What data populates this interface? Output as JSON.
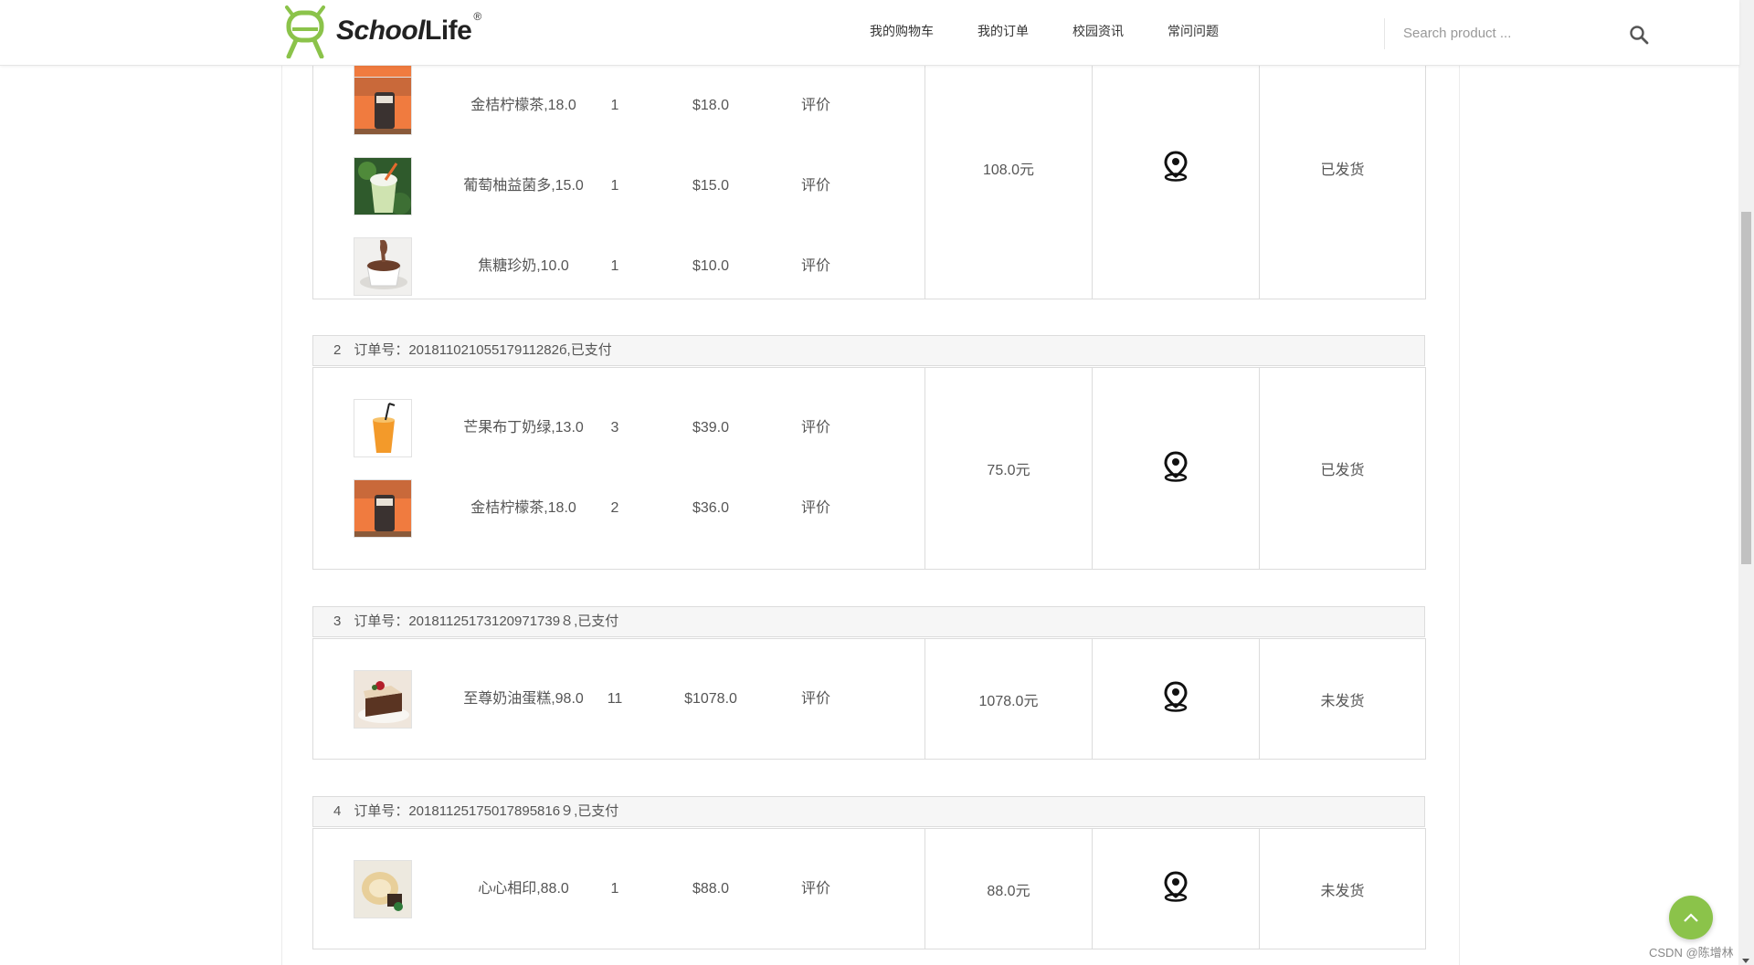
{
  "header": {
    "logo_text_italic": "School",
    "logo_text_bold": "Life",
    "logo_reg": "®",
    "nav": [
      "我的购物车",
      "我的订单",
      "校园资讯",
      "常问问题"
    ],
    "search_placeholder": "Search product ..."
  },
  "orders": [
    {
      "total": "108.0元",
      "status": "已发货",
      "items": [
        {
          "name": "金桔柠檬茶,18.0",
          "qty": "1",
          "price": "$18.0",
          "review": "评价",
          "thumb": "drink-orange-bg"
        },
        {
          "name": "葡萄柚益菌多,15.0",
          "qty": "1",
          "price": "$15.0",
          "review": "评价",
          "thumb": "drink-green"
        },
        {
          "name": "焦糖珍奶,10.0",
          "qty": "1",
          "price": "$10.0",
          "review": "评价",
          "thumb": "cocoa-cup"
        }
      ]
    },
    {
      "index": "2",
      "header": "订单号：20181102105517911282б,已支付",
      "total": "75.0元",
      "status": "已发货",
      "items": [
        {
          "name": "芒果布丁奶绿,13.0",
          "qty": "3",
          "price": "$39.0",
          "review": "评价",
          "thumb": "mango-drink"
        },
        {
          "name": "金桔柠檬茶,18.0",
          "qty": "2",
          "price": "$36.0",
          "review": "评价",
          "thumb": "drink-orange-bg"
        }
      ]
    },
    {
      "index": "3",
      "header": "订单号：20181125173120971739８,已支付",
      "total": "1078.0元",
      "status": "未发货",
      "items": [
        {
          "name": "至尊奶油蛋糕,98.0",
          "qty": "11",
          "price": "$1078.0",
          "review": "评价",
          "thumb": "cake-slice"
        }
      ]
    },
    {
      "index": "4",
      "header": "订单号：20181125175017895816９,已支付",
      "total": "88.0元",
      "status": "未发货",
      "items": [
        {
          "name": "心心相印,88.0",
          "qty": "1",
          "price": "$88.0",
          "review": "评价",
          "thumb": "cream-dessert"
        }
      ]
    }
  ],
  "watermark": "CSDN @陈增林",
  "colors": {
    "accent": "#8bc34a",
    "border": "#dcdcdc",
    "header_bg": "#f6f6f6"
  }
}
